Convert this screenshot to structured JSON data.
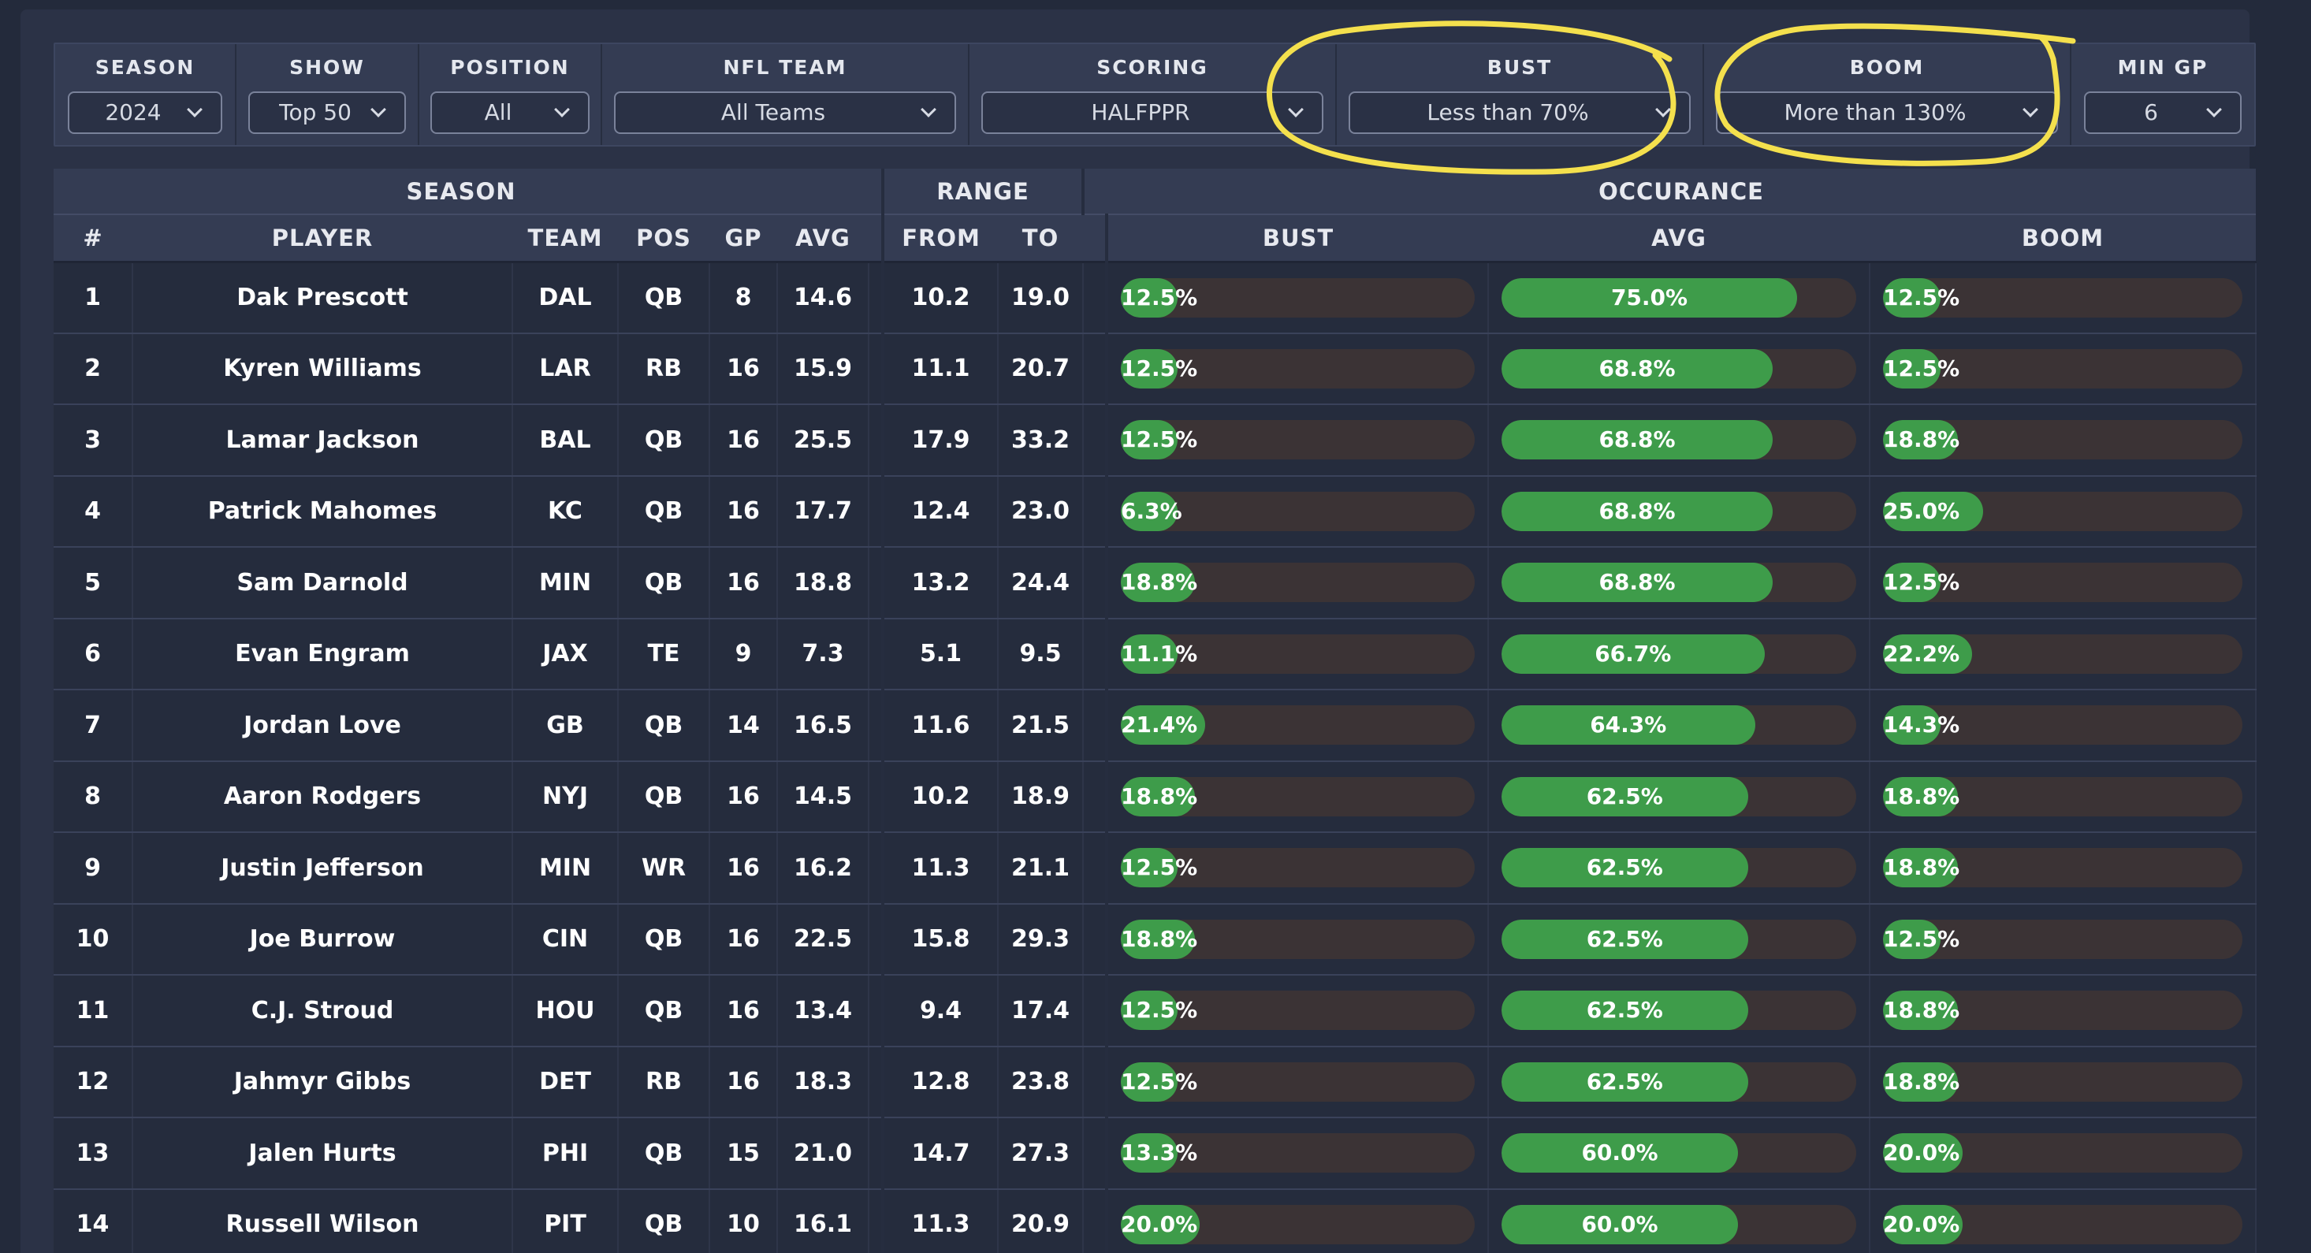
{
  "filters": [
    {
      "label": "SEASON",
      "value": "2024"
    },
    {
      "label": "SHOW",
      "value": "Top 50"
    },
    {
      "label": "POSITION",
      "value": "All"
    },
    {
      "label": "NFL TEAM",
      "value": "All Teams"
    },
    {
      "label": "SCORING",
      "value": "HALFPPR"
    },
    {
      "label": "BUST",
      "value": "Less than 70%"
    },
    {
      "label": "BOOM",
      "value": "More than 130%"
    },
    {
      "label": "MIN GP",
      "value": "6"
    }
  ],
  "table": {
    "groups": {
      "season": "SEASON",
      "range": "RANGE",
      "occurance": "OCCURANCE"
    },
    "columns": {
      "rank": "#",
      "player": "PLAYER",
      "team": "TEAM",
      "pos": "POS",
      "gp": "GP",
      "avg": "AVG",
      "from": "FROM",
      "to": "TO",
      "bust": "BUST",
      "occ_avg": "AVG",
      "boom": "BOOM"
    },
    "rows": [
      {
        "rank": "1",
        "player": "Dak Prescott",
        "team": "DAL",
        "pos": "QB",
        "gp": "8",
        "avg": "14.6",
        "from": "10.2",
        "to": "19.0",
        "bust": "12.5%",
        "occ_avg": "75.0%",
        "boom": "12.5%"
      },
      {
        "rank": "2",
        "player": "Kyren Williams",
        "team": "LAR",
        "pos": "RB",
        "gp": "16",
        "avg": "15.9",
        "from": "11.1",
        "to": "20.7",
        "bust": "12.5%",
        "occ_avg": "68.8%",
        "boom": "12.5%"
      },
      {
        "rank": "3",
        "player": "Lamar Jackson",
        "team": "BAL",
        "pos": "QB",
        "gp": "16",
        "avg": "25.5",
        "from": "17.9",
        "to": "33.2",
        "bust": "12.5%",
        "occ_avg": "68.8%",
        "boom": "18.8%"
      },
      {
        "rank": "4",
        "player": "Patrick Mahomes",
        "team": "KC",
        "pos": "QB",
        "gp": "16",
        "avg": "17.7",
        "from": "12.4",
        "to": "23.0",
        "bust": "6.3%",
        "occ_avg": "68.8%",
        "boom": "25.0%"
      },
      {
        "rank": "5",
        "player": "Sam Darnold",
        "team": "MIN",
        "pos": "QB",
        "gp": "16",
        "avg": "18.8",
        "from": "13.2",
        "to": "24.4",
        "bust": "18.8%",
        "occ_avg": "68.8%",
        "boom": "12.5%"
      },
      {
        "rank": "6",
        "player": "Evan Engram",
        "team": "JAX",
        "pos": "TE",
        "gp": "9",
        "avg": "7.3",
        "from": "5.1",
        "to": "9.5",
        "bust": "11.1%",
        "occ_avg": "66.7%",
        "boom": "22.2%"
      },
      {
        "rank": "7",
        "player": "Jordan Love",
        "team": "GB",
        "pos": "QB",
        "gp": "14",
        "avg": "16.5",
        "from": "11.6",
        "to": "21.5",
        "bust": "21.4%",
        "occ_avg": "64.3%",
        "boom": "14.3%"
      },
      {
        "rank": "8",
        "player": "Aaron Rodgers",
        "team": "NYJ",
        "pos": "QB",
        "gp": "16",
        "avg": "14.5",
        "from": "10.2",
        "to": "18.9",
        "bust": "18.8%",
        "occ_avg": "62.5%",
        "boom": "18.8%"
      },
      {
        "rank": "9",
        "player": "Justin Jefferson",
        "team": "MIN",
        "pos": "WR",
        "gp": "16",
        "avg": "16.2",
        "from": "11.3",
        "to": "21.1",
        "bust": "12.5%",
        "occ_avg": "62.5%",
        "boom": "18.8%"
      },
      {
        "rank": "10",
        "player": "Joe Burrow",
        "team": "CIN",
        "pos": "QB",
        "gp": "16",
        "avg": "22.5",
        "from": "15.8",
        "to": "29.3",
        "bust": "18.8%",
        "occ_avg": "62.5%",
        "boom": "12.5%"
      },
      {
        "rank": "11",
        "player": "C.J. Stroud",
        "team": "HOU",
        "pos": "QB",
        "gp": "16",
        "avg": "13.4",
        "from": "9.4",
        "to": "17.4",
        "bust": "12.5%",
        "occ_avg": "62.5%",
        "boom": "18.8%"
      },
      {
        "rank": "12",
        "player": "Jahmyr Gibbs",
        "team": "DET",
        "pos": "RB",
        "gp": "16",
        "avg": "18.3",
        "from": "12.8",
        "to": "23.8",
        "bust": "12.5%",
        "occ_avg": "62.5%",
        "boom": "18.8%"
      },
      {
        "rank": "13",
        "player": "Jalen Hurts",
        "team": "PHI",
        "pos": "QB",
        "gp": "15",
        "avg": "21.0",
        "from": "14.7",
        "to": "27.3",
        "bust": "13.3%",
        "occ_avg": "60.0%",
        "boom": "20.0%"
      },
      {
        "rank": "14",
        "player": "Russell Wilson",
        "team": "PIT",
        "pos": "QB",
        "gp": "10",
        "avg": "16.1",
        "from": "11.3",
        "to": "20.9",
        "bust": "20.0%",
        "occ_avg": "60.0%",
        "boom": "20.0%"
      }
    ]
  },
  "colors": {
    "bar_fill": "#3e9c4a",
    "bar_track": "#3b3335",
    "annotation": "#f4e04d"
  }
}
